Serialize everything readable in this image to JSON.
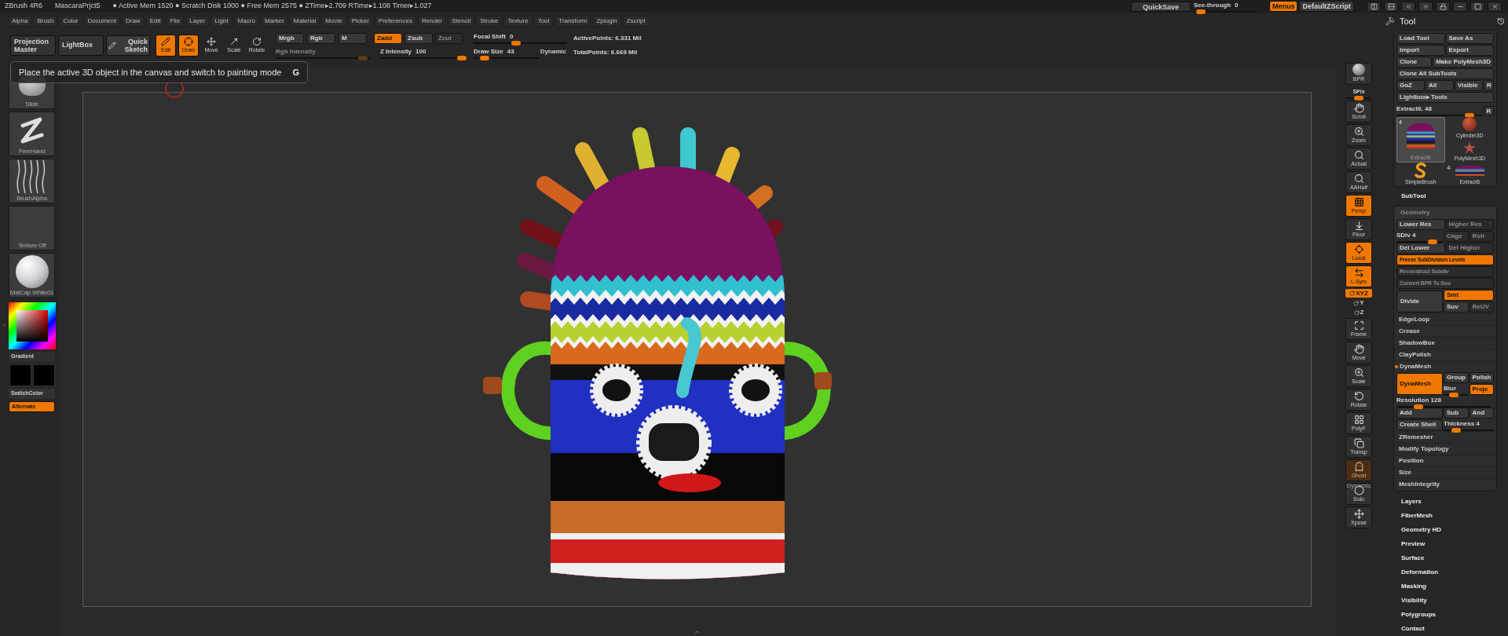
{
  "title_bar": {
    "app": "ZBrush 4R6",
    "project": "MascaraPrjct5",
    "stats": "● Active Mem 1520 ● Scratch Disk 1000 ● Free Mem 2575 ● ZTime▸2.709 RTime▸1.108 Timer▸1.027",
    "quicksave": "QuickSave",
    "see_through": {
      "label": "See-through",
      "reading": "0",
      "level": 0.05
    },
    "buttons": [
      {
        "label": "Menus",
        "on": true
      },
      {
        "label": "DefaultZScript",
        "on": false
      }
    ]
  },
  "menu": [
    "Alpha",
    "Brush",
    "Color",
    "Document",
    "Draw",
    "Edit",
    "File",
    "Layer",
    "Light",
    "Macro",
    "Marker",
    "Material",
    "Movie",
    "Picker",
    "Preferences",
    "Render",
    "Stencil",
    "Stroke",
    "Texture",
    "Tool",
    "Transform",
    "Zplugin",
    "Zscript"
  ],
  "toolbar": {
    "projection_master": "Projection Master",
    "lightbox": "LightBox",
    "quick_sketch": "Quick Sketch",
    "modes": [
      {
        "label": "Edit",
        "selected": true
      },
      {
        "label": "Draw",
        "selected": true
      },
      {
        "label": "Move",
        "selected": false
      },
      {
        "label": "Scale",
        "selected": false
      },
      {
        "label": "Rotate",
        "selected": false
      }
    ],
    "color_modes": [
      {
        "label": "Mrgb",
        "on": false,
        "disabled": false
      },
      {
        "label": "Rgb",
        "on": false,
        "disabled": false
      },
      {
        "label": "M",
        "on": false,
        "disabled": false
      }
    ],
    "rgb_intensity": {
      "label": "Rgb Intensity",
      "disabled": true,
      "level": 0.97
    },
    "depth_modes": [
      {
        "label": "Zadd",
        "on": true,
        "disabled": false
      },
      {
        "label": "Zsub",
        "on": false,
        "disabled": false
      },
      {
        "label": "Zcut",
        "on": false,
        "disabled": true
      }
    ],
    "z_intensity": {
      "label": "Z Intensity",
      "reading": "100",
      "level": 1
    },
    "focal_shift": {
      "label": "Focal Shift",
      "reading": "0",
      "level": 0.45
    },
    "draw_size": {
      "label": "Draw Size",
      "reading": "43",
      "level": 0.12
    },
    "dynamic": "Dynamic",
    "active_points": "ActivePoints: 6.331 Mil",
    "total_points": "TotalPoints: 6.669 Mil"
  },
  "tooltip": {
    "text": "Place the active 3D object in the canvas and switch to painting mode",
    "shortcut": "G"
  },
  "left_palette": {
    "thumbnails": [
      {
        "label": "Slide",
        "kind": "brush"
      },
      {
        "label": "FreeHand",
        "kind": "stroke"
      },
      {
        "label": "BrushAlpha",
        "kind": "alpha"
      },
      {
        "label": "Texture Off",
        "kind": "texture"
      },
      {
        "label": "MatCap White01",
        "kind": "material"
      }
    ],
    "gradient": "Gradient",
    "switch_color": "SwitchColor",
    "alternate": {
      "label": "Alternate",
      "on": true
    }
  },
  "shelf": [
    {
      "label": "BPR",
      "kind": "button",
      "on": false,
      "disabled": false
    },
    {
      "label": "SPix",
      "kind": "slider",
      "level": 0.5
    },
    {
      "label": "Scroll",
      "kind": "button",
      "on": false,
      "disabled": false
    },
    {
      "label": "Zoom",
      "kind": "button",
      "on": false,
      "disabled": false
    },
    {
      "label": "Actual",
      "kind": "button",
      "on": false,
      "disabled": false
    },
    {
      "label": "AAHalf",
      "kind": "button",
      "on": false,
      "disabled": false
    },
    {
      "label": "Persp",
      "kind": "button",
      "on": true,
      "disabled": false
    },
    {
      "label": "Floor",
      "kind": "button",
      "on": false,
      "disabled": false
    },
    {
      "label": "Local",
      "kind": "button",
      "on": true,
      "disabled": false
    },
    {
      "label": "L.Sym",
      "kind": "button",
      "on": true,
      "disabled": false
    },
    {
      "label": "XYZ",
      "kind": "axis",
      "on": true,
      "disabled": false
    },
    {
      "label": "Y",
      "kind": "axis",
      "on": false,
      "disabled": false
    },
    {
      "label": "Z",
      "kind": "axis",
      "on": false,
      "disabled": false
    },
    {
      "label": "Frame",
      "kind": "button",
      "on": false,
      "disabled": false
    },
    {
      "label": "Move",
      "kind": "button",
      "on": false,
      "disabled": false
    },
    {
      "label": "Scale",
      "kind": "button",
      "on": false,
      "disabled": false
    },
    {
      "label": "Rotate",
      "kind": "button",
      "on": false,
      "disabled": false
    },
    {
      "label": "PolyF",
      "kind": "button",
      "on": false,
      "disabled": false
    },
    {
      "label": "Transp",
      "kind": "button",
      "on": false,
      "disabled": false
    },
    {
      "label": "Ghost",
      "kind": "button",
      "on": false,
      "disabled": true
    },
    {
      "label": "Solo",
      "kind": "button",
      "on": false,
      "disabled": false,
      "note": "Dynamic"
    },
    {
      "label": "Xpose",
      "kind": "button",
      "on": false,
      "disabled": false
    }
  ],
  "tool_panel": {
    "title": "Tool",
    "rows": [
      [
        "Load Tool",
        "Save As"
      ],
      [
        "Import",
        "Export"
      ],
      [
        "Clone",
        "Make PolyMesh3D"
      ],
      [
        "Clone All SubTools"
      ],
      [
        "GoZ",
        "All",
        "Visible",
        "R"
      ],
      [
        "Lightbox▸ Tools"
      ]
    ],
    "extract": {
      "label": "Extract6. 48",
      "level": 0.9,
      "reset": "R"
    },
    "thumbnails": [
      {
        "label": "Extract6",
        "count": "4",
        "kind": "mask",
        "selected": true
      },
      {
        "label": "Cylinder3D",
        "kind": "cylinder",
        "selected": false
      },
      {
        "label": "PolyMesh3D",
        "kind": "star",
        "selected": false
      },
      {
        "label": "SimpleBrush",
        "kind": "brush",
        "selected": false
      },
      {
        "label": "Extract6",
        "count": "4",
        "kind": "mask",
        "selected": false
      }
    ]
  },
  "subtool": "SubTool",
  "geometry": {
    "title": "Geometry",
    "rows": [
      [
        {
          "kind": "button",
          "label": "Lower Res",
          "on": false,
          "disabled": false
        },
        {
          "kind": "button",
          "label": "Higher Res",
          "on": false,
          "disabled": true
        }
      ],
      [
        {
          "kind": "slider",
          "label": "SDiv 4",
          "level": 0.85
        },
        {
          "kind": "button",
          "label": "Cage",
          "on": false,
          "disabled": true
        },
        {
          "kind": "button",
          "label": "Rstr",
          "on": false,
          "disabled": true
        }
      ],
      [
        {
          "kind": "button",
          "label": "Del Lower",
          "on": false,
          "disabled": false
        },
        {
          "kind": "button",
          "label": "Del Higher",
          "on": false,
          "disabled": true
        }
      ],
      [
        {
          "kind": "button",
          "label": "Freeze SubDivision Levels",
          "on": true,
          "disabled": false
        }
      ],
      [
        {
          "kind": "button",
          "label": "Reconstruct Subdiv",
          "on": false,
          "disabled": true
        }
      ],
      [
        {
          "kind": "button",
          "label": "Convert BPR To Geo",
          "on": false,
          "disabled": true
        }
      ]
    ],
    "divide": {
      "label": "Divide",
      "options": [
        {
          "label": "Smt",
          "on": true,
          "disabled": false
        },
        {
          "label": "Suv",
          "on": false,
          "disabled": false
        },
        {
          "label": "ReUV",
          "on": false,
          "disabled": true
        }
      ]
    },
    "subsections": [
      {
        "label": "EdgeLoop",
        "expanded": false
      },
      {
        "label": "Crease",
        "expanded": false
      },
      {
        "label": "ShadowBox",
        "expanded": false
      },
      {
        "label": "ClayPolish",
        "expanded": false
      },
      {
        "label": "DynaMesh",
        "expanded": true,
        "controls": {
          "dynamesh": {
            "label": "DynaMesh",
            "on": true
          },
          "group": {
            "label": "Group",
            "on": false
          },
          "polish": {
            "label": "Polish",
            "on": false
          },
          "blur": {
            "label": "Blur",
            "level": 0.35
          },
          "project": {
            "label": "Proje",
            "on": true
          },
          "resolution": {
            "label": "Resolution 128",
            "level": 0.2
          },
          "add": {
            "label": "Add",
            "on": false
          },
          "sub": {
            "label": "Sub",
            "on": false
          },
          "and": {
            "label": "And",
            "on": false
          },
          "create_shell": {
            "label": "Create Shell",
            "on": false
          },
          "thickness": {
            "label": "Thickness 4",
            "level": 0.2
          }
        }
      },
      {
        "label": "ZRemesher",
        "expanded": false
      },
      {
        "label": "Modify Topology",
        "expanded": false
      },
      {
        "label": "Position",
        "expanded": false
      },
      {
        "label": "Size",
        "expanded": false
      },
      {
        "label": "MeshIntegrity",
        "expanded": false
      }
    ]
  },
  "sections": [
    "Layers",
    "FiberMesh",
    "Geometry HD",
    "Preview",
    "Surface",
    "Deformation",
    "Masking",
    "Visibility",
    "Polygroups",
    "Contact"
  ]
}
